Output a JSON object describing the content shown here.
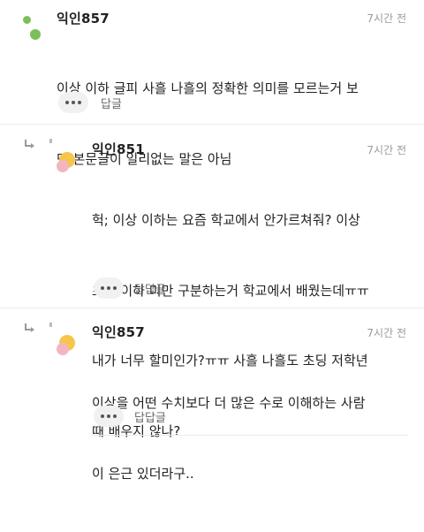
{
  "comments": [
    {
      "nickname": "익인857",
      "time": "7시간 전",
      "lines": [
        "이상 이하 글피 사흘 나흘의 정확한 의미를 모르는거 보",
        "면 본문글이 일리없는 말은 아님"
      ],
      "reply_label": "답글",
      "avatar": "green-dots-avatar",
      "color": "#7bbf5a"
    },
    {
      "nickname": "익인851",
      "time": "7시간 전",
      "lines": [
        "헉; 이상 이하는 요즘 학교에서 안가르쳐줘? 이상",
        "초과 이하 미만 구분하는거 학교에서 배웠는데ㅠㅠ",
        "내가 너무 할미인가?ㅠㅠ 사흘 나흘도 초딩 저학년",
        "때 배우지 않나?"
      ],
      "reply_label": "답답글",
      "avatar": "chick-avatar"
    },
    {
      "nickname": "익인857",
      "time": "7시간 전",
      "lines": [
        "이상을 어떤 수치보다 더 많은 수로 이해하는 사람",
        "이 은근 있더라구.."
      ],
      "reply_label": "답답글",
      "avatar": "chick-avatar"
    }
  ],
  "colors": {
    "avatar_green": "#7bbf5a",
    "avatar_yellow": "#f6c64a",
    "avatar_pink": "#f3b6c1"
  }
}
